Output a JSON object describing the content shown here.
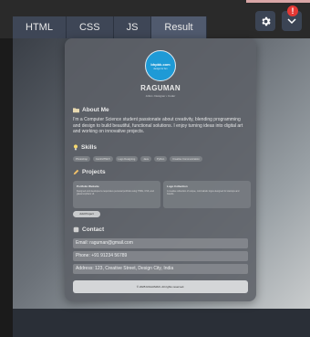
{
  "tabs": [
    "HTML",
    "CSS",
    "JS",
    "Result"
  ],
  "toolbar": {
    "notification_count": "!"
  },
  "profile": {
    "avatar_title": "bhpbk.com",
    "avatar_sub": "design for fun",
    "name": "RAGUMAN",
    "tagline": "Artist • Designer • Coder"
  },
  "about": {
    "title": "About Me",
    "text": "I'm a Computer Science student passionate about creativity, blending programming and design to build beautiful, functional solutions. I enjoy turning ideas into digital art and working on innovative projects."
  },
  "skills": {
    "title": "Skills",
    "items": [
      "Photoshop",
      "Css3/HTML5",
      "Logo Designing",
      "Java",
      "Python",
      "Creative Communication"
    ]
  },
  "projects": {
    "title": "Projects",
    "items": [
      {
        "title": "Portfolio Website",
        "desc": "Designed and developed a responsive personal portfolio using HTML, CSS, and glassmorphism UI."
      },
      {
        "title": "Logo Collection",
        "desc": "A creative collection of unique, minimalistic logos designed for startups and brands."
      }
    ],
    "add_label": "Add Project"
  },
  "contact": {
    "title": "Contact",
    "email": "Email: raguman@gmail.com",
    "phone": "Phone: +91 91234 56789",
    "address": "Address: 123, Creative Street, Design City, India"
  },
  "footer": "© 2025 RAGUMAN. All rights reserved.",
  "colors": {
    "avatar": "#1e9ad6",
    "badge": "#e53935",
    "tab": "#3e4656"
  }
}
